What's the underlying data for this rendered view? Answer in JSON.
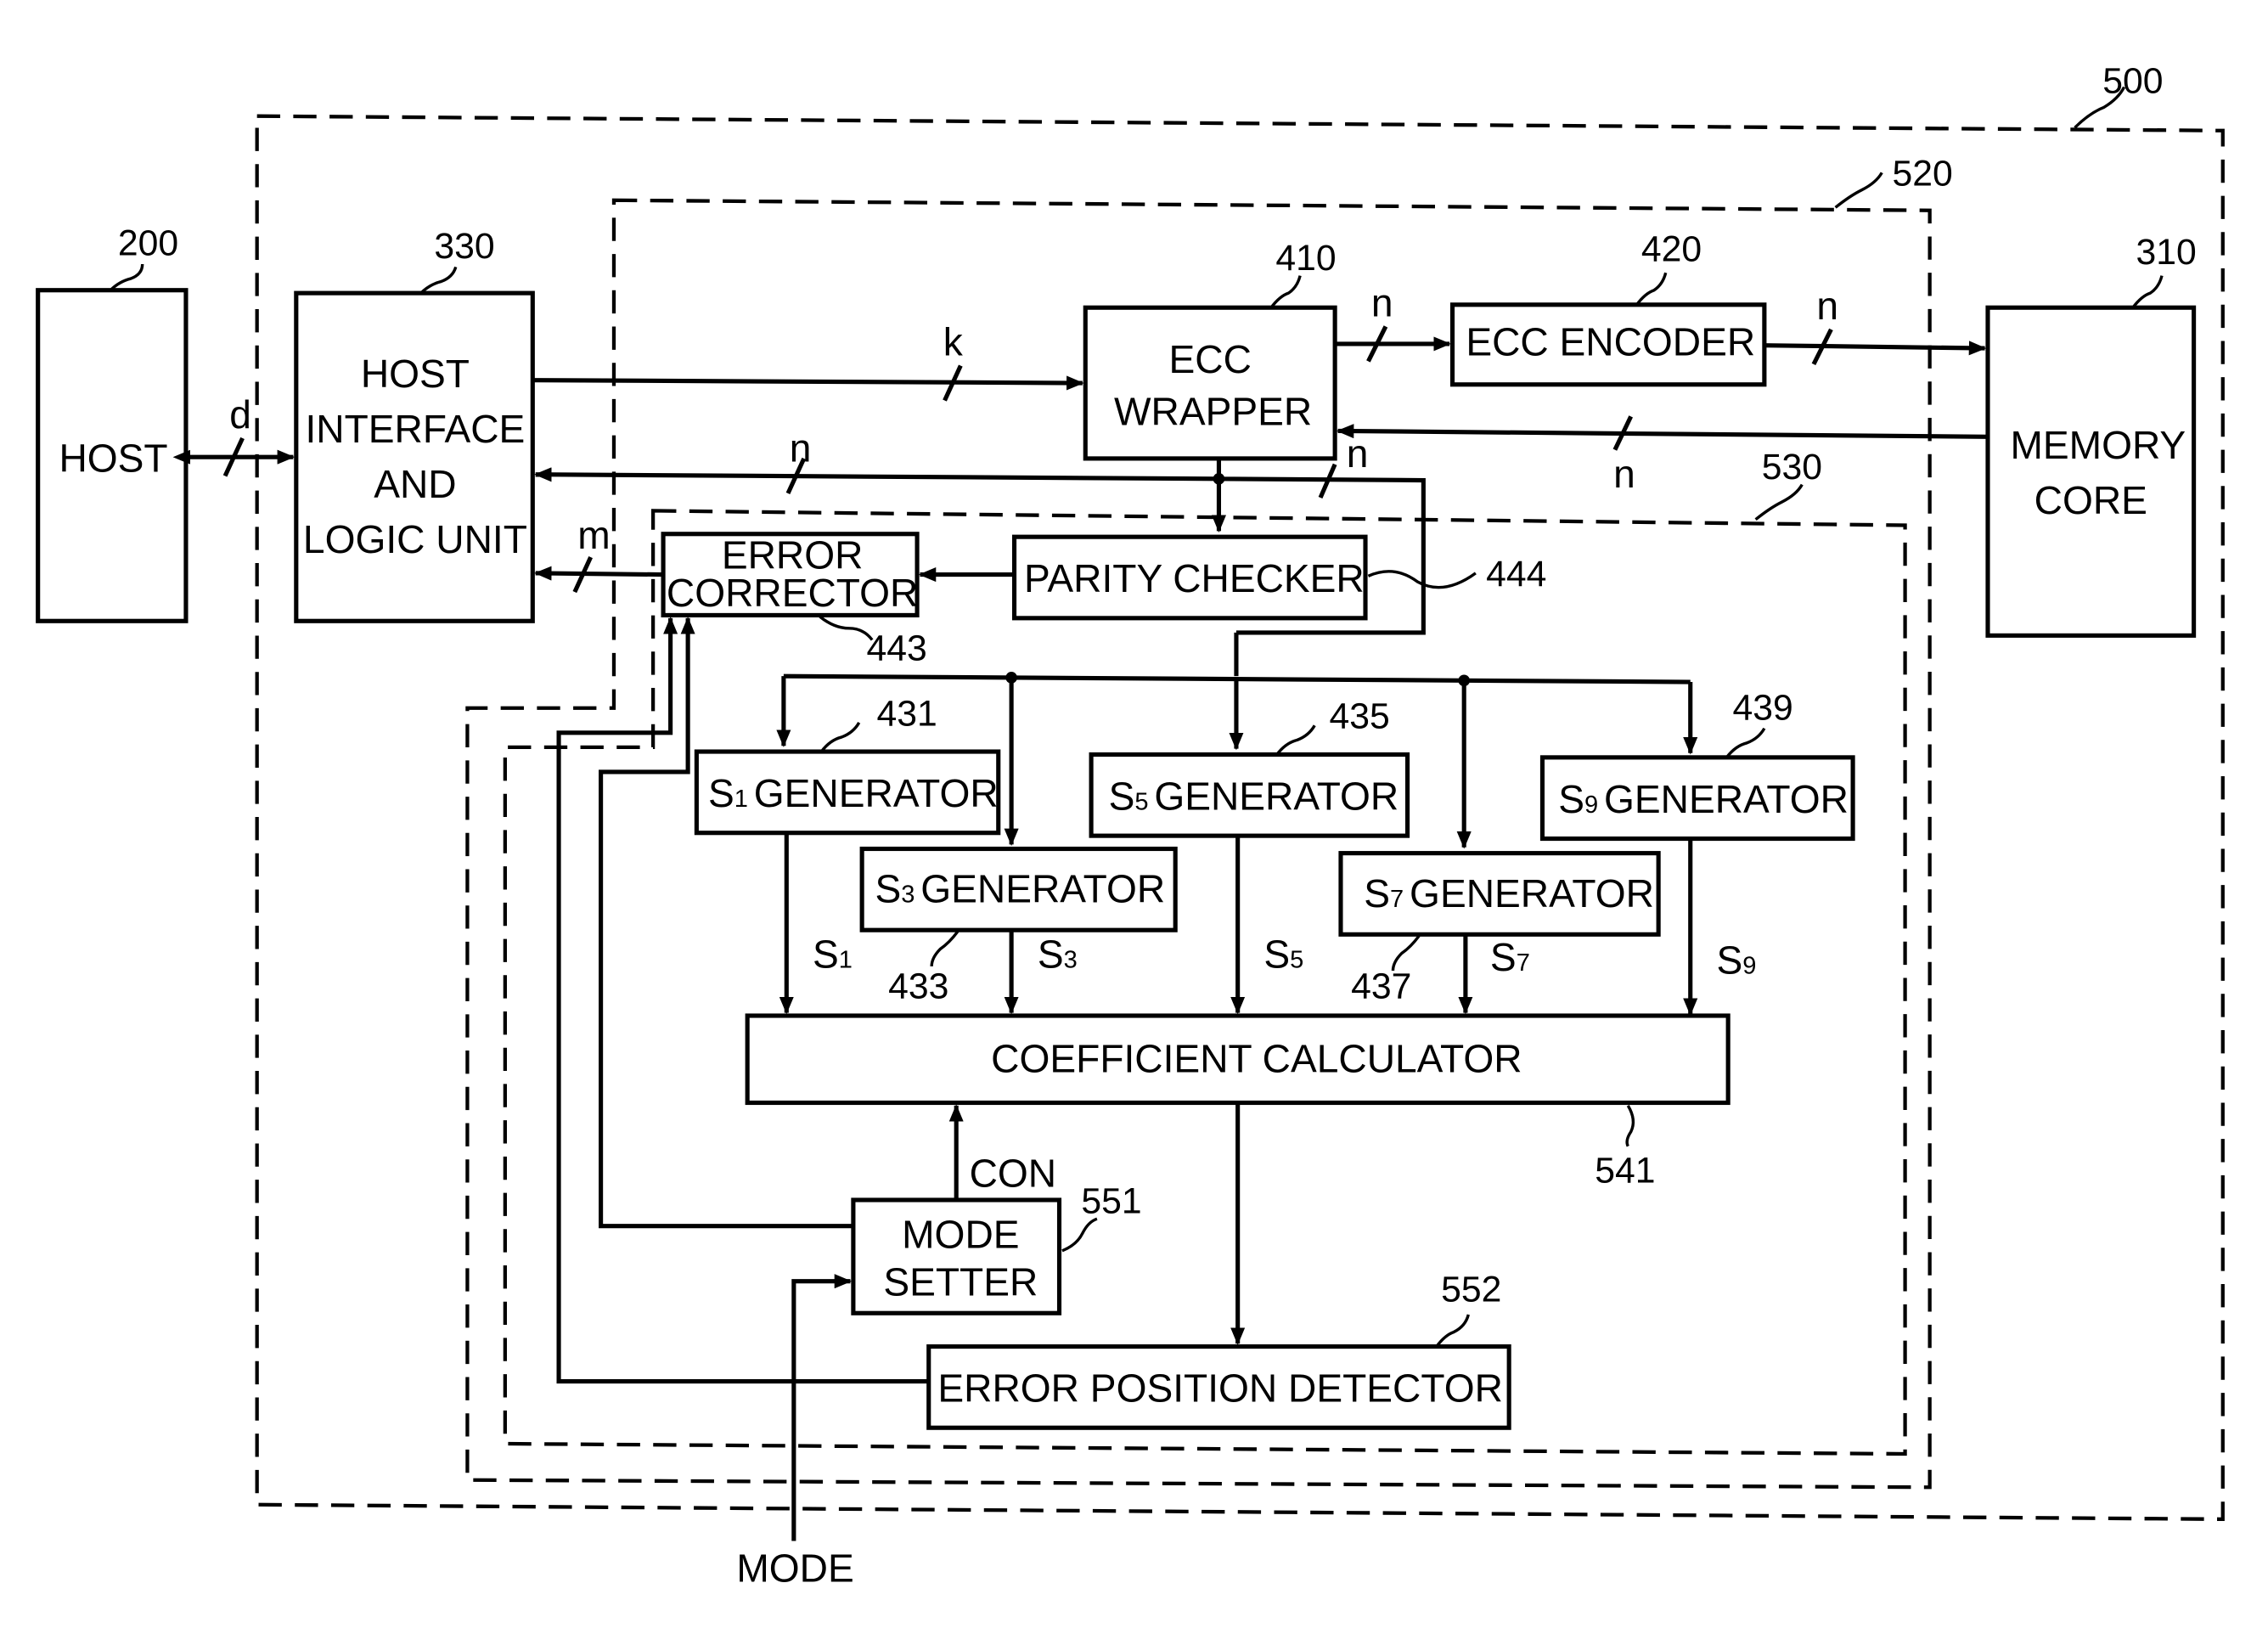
{
  "diagram": {
    "containers": {
      "outer": {
        "ref": "500"
      },
      "ecc_block": {
        "ref": "520"
      },
      "decoder_block": {
        "ref": "530"
      }
    },
    "blocks": {
      "host": {
        "ref": "200",
        "label": "HOST"
      },
      "host_interface": {
        "ref": "330",
        "lines": [
          "HOST",
          "INTERFACE",
          "AND",
          "LOGIC UNIT"
        ]
      },
      "ecc_wrapper": {
        "ref": "410",
        "lines": [
          "ECC",
          "WRAPPER"
        ]
      },
      "ecc_encoder": {
        "ref": "420",
        "label": "ECC ENCODER"
      },
      "memory_core": {
        "ref": "310",
        "lines": [
          "MEMORY",
          "CORE"
        ]
      },
      "error_corrector": {
        "ref": "443",
        "lines": [
          "ERROR",
          "CORRECTOR"
        ]
      },
      "parity_checker": {
        "ref": "444",
        "label": "PARITY CHECKER"
      },
      "s1": {
        "ref": "431",
        "sym": "S",
        "idx": "1",
        "label": "GENERATOR"
      },
      "s3": {
        "ref": "433",
        "sym": "S",
        "idx": "3",
        "label": "GENERATOR"
      },
      "s5": {
        "ref": "435",
        "sym": "S",
        "idx": "5",
        "label": "GENERATOR"
      },
      "s7": {
        "ref": "437",
        "sym": "S",
        "idx": "7",
        "label": "GENERATOR"
      },
      "s9": {
        "ref": "439",
        "sym": "S",
        "idx": "9",
        "label": "GENERATOR"
      },
      "coefficient_calculator": {
        "ref": "541",
        "label": "COEFFICIENT CALCULATOR"
      },
      "mode_setter": {
        "ref": "551",
        "lines": [
          "MODE",
          "SETTER"
        ]
      },
      "error_position_detector": {
        "ref": "552",
        "label": "ERROR POSITION DETECTOR"
      }
    },
    "signals": {
      "d": "d",
      "k": "k",
      "n": "n",
      "m": "m",
      "con": "CON",
      "mode": "MODE",
      "s1": "S",
      "s3": "S",
      "s5": "S",
      "s7": "S",
      "s9": "S",
      "s1_idx": "1",
      "s3_idx": "3",
      "s5_idx": "5",
      "s7_idx": "7",
      "s9_idx": "9"
    }
  }
}
